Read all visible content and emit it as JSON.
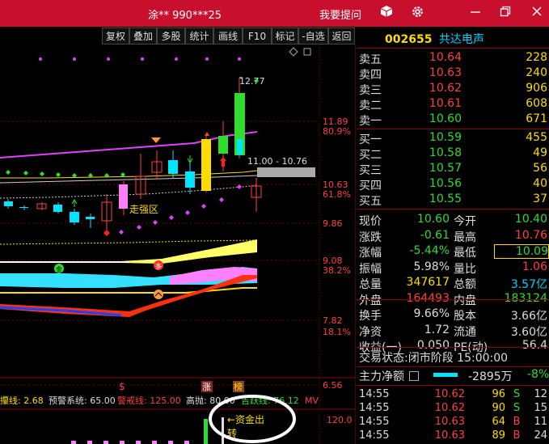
{
  "window": {
    "title": "涂**  990***25",
    "ask_label": "我要提问"
  },
  "toolbar": [
    "复权",
    "叠加",
    "多股",
    "统计",
    "画线",
    "F10",
    "标记",
    "-自选",
    "返回"
  ],
  "stock": {
    "code": "002655",
    "name": "共达电声"
  },
  "asks": [
    {
      "label": "卖五",
      "price": "10.64",
      "vol": "228"
    },
    {
      "label": "卖四",
      "price": "10.63",
      "vol": "240"
    },
    {
      "label": "卖三",
      "price": "10.62",
      "vol": "906"
    },
    {
      "label": "卖二",
      "price": "10.61",
      "vol": "608"
    },
    {
      "label": "卖一",
      "price": "10.60",
      "vol": "671"
    }
  ],
  "bids": [
    {
      "label": "买一",
      "price": "10.59",
      "vol": "455"
    },
    {
      "label": "买二",
      "price": "10.58",
      "vol": "49"
    },
    {
      "label": "买三",
      "price": "10.57",
      "vol": "56"
    },
    {
      "label": "买四",
      "price": "10.56",
      "vol": "40"
    },
    {
      "label": "买五",
      "price": "10.55",
      "vol": "37"
    }
  ],
  "stats": [
    {
      "l1": "现价",
      "v1": "10.60",
      "c1": "#2fdc2f",
      "l2": "今开",
      "v2": "10.40",
      "c2": "#2fdc2f"
    },
    {
      "l1": "涨跌",
      "v1": "-0.61",
      "c1": "#2fdc2f",
      "l2": "最高",
      "v2": "10.76",
      "c2": "#ff4040"
    },
    {
      "l1": "涨幅",
      "v1": "-5.44%",
      "c1": "#2fdc2f",
      "l2": "最低",
      "v2": "10.09",
      "c2": "#2fdc2f"
    },
    {
      "l1": "振幅",
      "v1": "5.98%",
      "c1": "#ddd",
      "l2": "量比",
      "v2": "1.06",
      "c2": "#ff4040"
    },
    {
      "l1": "总量",
      "v1": "347617",
      "c1": "#ffdc00",
      "l2": "总额",
      "v2": "3.57亿",
      "c2": "#00d0ff"
    },
    {
      "l1": "外盘",
      "v1": "164493",
      "c1": "#ff4040",
      "l2": "内盘",
      "v2": "183124",
      "c2": "#2fdc2f"
    },
    {
      "l1": "换手",
      "v1": "9.66%",
      "c1": "#ddd",
      "l2": "股本",
      "v2": "3.66亿",
      "c2": "#ddd"
    },
    {
      "l1": "净资",
      "v1": "1.72",
      "c1": "#ddd",
      "l2": "流通",
      "v2": "3.60亿",
      "c2": "#ddd"
    },
    {
      "l1": "收益(一)",
      "v1": "0.050",
      "c1": "#ddd",
      "l2": "PE(动)",
      "v2": "56.4",
      "c2": "#ddd"
    }
  ],
  "status": {
    "label": "交易状态:",
    "value": "闭市阶段 15:00:00"
  },
  "netflow": {
    "label": "主力净额",
    "value": "-2895万",
    "pct": "-8%"
  },
  "ticks": [
    {
      "t": "14:55",
      "p": "10.62",
      "v": "96",
      "s": "S",
      "n": "12"
    },
    {
      "t": "14:55",
      "p": "10.62",
      "v": "90",
      "s": "S",
      "n": "15"
    },
    {
      "t": "14:55",
      "p": "10.63",
      "v": "64",
      "s": "B",
      "n": "11"
    },
    {
      "t": "14:55",
      "p": "10.63",
      "v": "89",
      "s": "B",
      "n": "24"
    }
  ],
  "chart": {
    "price_labels": [
      "11.89",
      "10.63",
      "9.86",
      "9.08",
      "7.82",
      "6.56"
    ],
    "pct_labels": [
      "80.9%",
      "61.8%",
      "38.2%",
      "18.1%"
    ],
    "high_label": "12.77",
    "range_label": "11.00 - 10.76",
    "zone_label": "走强区",
    "markers": [
      "$",
      "涨",
      "榜"
    ],
    "indicator_bar": [
      {
        "text": "攥线: 2.68",
        "color": "#ffdc00"
      },
      {
        "text": "预警系统: 65.00",
        "color": "#ddd"
      },
      {
        "text": "警戒线: 125.00",
        "color": "#ff4040"
      },
      {
        "text": "高抛: 80.00",
        "color": "#ddd"
      },
      {
        "text": "吉跃线: 76.12",
        "color": "#2fdc2f"
      },
      {
        "text": "MV",
        "color": "#ff4040"
      }
    ],
    "sub_label": "120.0",
    "annot1": "←资金出",
    "annot2": "转"
  }
}
